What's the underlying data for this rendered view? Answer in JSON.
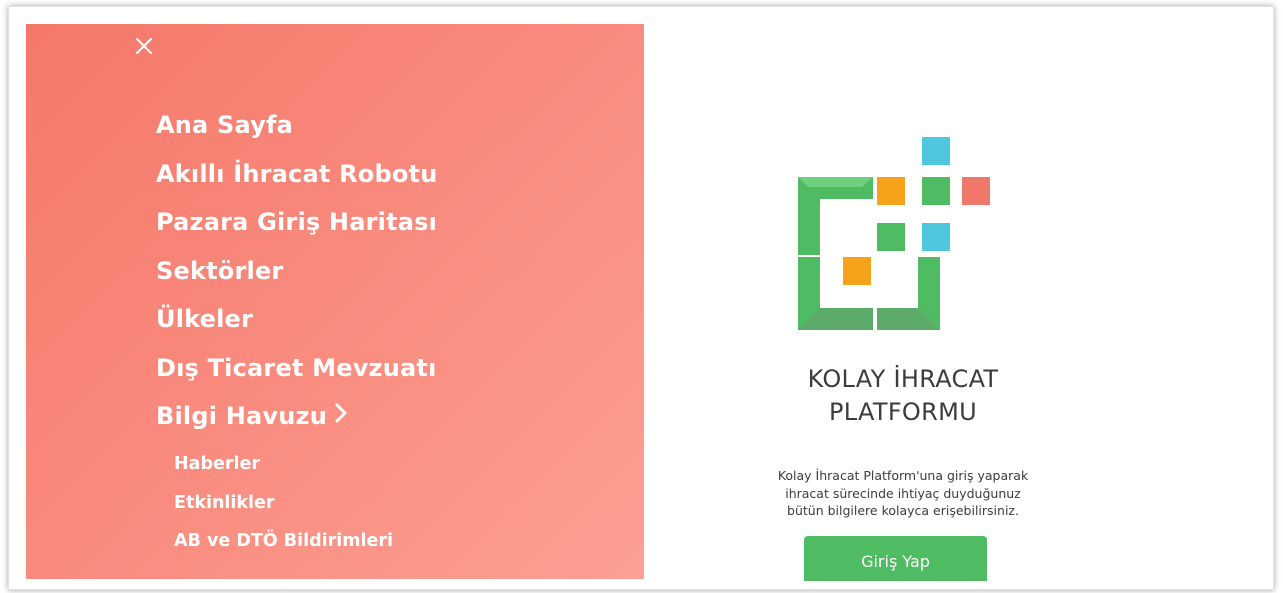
{
  "menu": {
    "close_icon": "close-icon",
    "items": [
      {
        "label": "Ana Sayfa"
      },
      {
        "label": "Akıllı İhracat Robotu"
      },
      {
        "label": "Pazara Giriş Haritası"
      },
      {
        "label": "Sektörler"
      },
      {
        "label": "Ülkeler"
      },
      {
        "label": "Dış Ticaret Mevzuatı"
      },
      {
        "label": "Bilgi Havuzu",
        "icon": "chevron-right-icon"
      }
    ],
    "sub_items": [
      {
        "label": "Haberler"
      },
      {
        "label": "Etkinlikler"
      },
      {
        "label": "AB ve DTÖ Bildirimleri"
      }
    ]
  },
  "platform": {
    "title_line1": "KOLAY İHRACAT",
    "title_line2": "PLATFORMU",
    "description_line1": "Kolay İhracat Platform'una giriş yaparak",
    "description_line2": "ihracat sürecinde ihtiyaç duyduğunuz",
    "description_line3": "bütün bilgilere kolayca erişebilirsiniz.",
    "login_label": "Giriş Yap"
  },
  "colors": {
    "menu_gradient_start": "#f47869",
    "menu_gradient_end": "#fba093",
    "logo_green": "#4fbb62",
    "logo_orange": "#f6a21b",
    "logo_cyan": "#4fc8df",
    "logo_red": "#f0786a",
    "button_green": "#4fbb62"
  }
}
